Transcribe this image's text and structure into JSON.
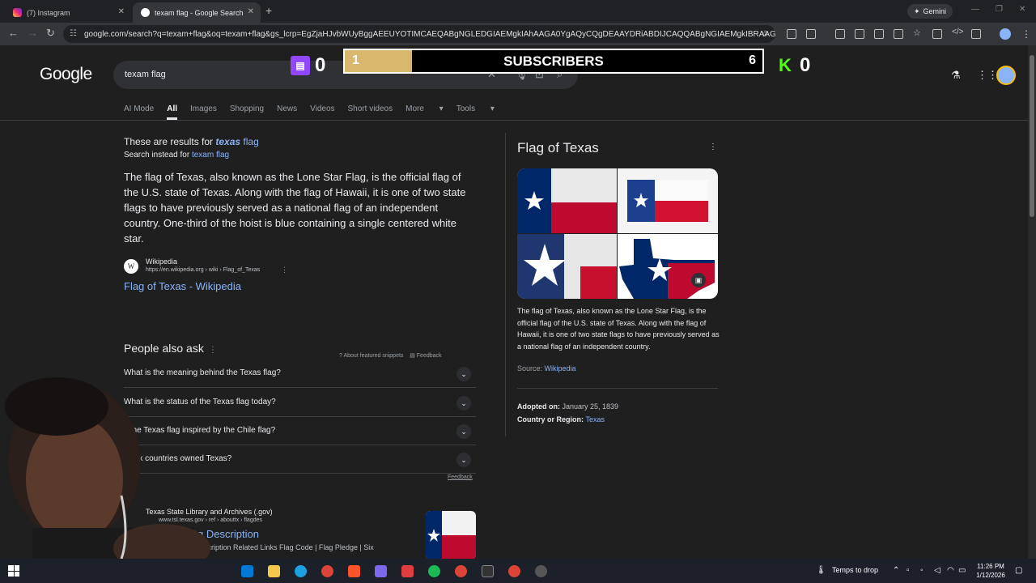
{
  "browser": {
    "tabs": [
      {
        "label": "(7) Instagram",
        "active": false
      },
      {
        "label": "texam flag - Google Search",
        "active": true
      }
    ],
    "gemini_label": "Gemini",
    "url": "google.com/search?q=texam+flag&oq=texam+flag&gs_lcrp=EgZjaHJvbWUyBggAEEUYOTIMCAEQABgNGLEDGIAEMgkIAhAAGA0YgAQyCQgDEAAYDRiABDIJCAQQABgNGIAEMgkIBRAAGA0YgAQyCQ..."
  },
  "google": {
    "logo": "Google",
    "query": "texam flag",
    "filters": [
      "AI Mode",
      "All",
      "Images",
      "Shopping",
      "News",
      "Videos",
      "Short videos",
      "More",
      "Tools"
    ],
    "active_filter": "All"
  },
  "correction": {
    "prefix": "These are results for ",
    "corrected_bold": "texas",
    "corrected_rest": " flag",
    "instead_prefix": "Search instead for ",
    "instead_link": "texam flag"
  },
  "featured": {
    "snippet": "The flag of Texas, also known as the Lone Star Flag, is the official flag of the U.S. state of Texas. Along with the flag of Hawaii, it is one of two state flags to have previously served as a national flag of an independent country. One-third of the hoist is blue containing a single centered white star.",
    "source_name": "Wikipedia",
    "source_url": "https://en.wikipedia.org › wiki › Flag_of_Texas",
    "title": "Flag of Texas - Wikipedia",
    "about": "About featured snippets",
    "feedback": "Feedback"
  },
  "paa": {
    "heading": "People also ask",
    "questions": [
      "What is the meaning behind the Texas flag?",
      "What is the status of the Texas flag today?",
      "s the Texas flag inspired by the Chile flag?",
      "at six countries owned Texas?"
    ],
    "feedback": "Feedback"
  },
  "result2": {
    "name": "Texas State Library and Archives (.gov)",
    "url": "www.tsl.texas.gov › ref › abouttx › flagdes",
    "title": "Flag Description",
    "desc": "lag Description Related Links Flag Code | Flag Pledge | Six"
  },
  "knowledge": {
    "title": "Flag of Texas",
    "description": "The flag of Texas, also known as the Lone Star Flag, is the official flag of the U.S. state of Texas. Along with the flag of Hawaii, it is one of two state flags to have previously served as a national flag of an independent country.",
    "source_label": "Source: ",
    "source_link": "Wikipedia",
    "adopted_label": "Adopted on: ",
    "adopted_value": "January 25, 1839",
    "region_label": "Country or Region: ",
    "region_value": "Texas"
  },
  "overlay": {
    "twitch_count": "0",
    "sub_current": "1",
    "sub_label": "SUBSCRIBERS",
    "sub_goal": "6",
    "sub_progress": 0.16,
    "kick_count": "0"
  },
  "taskbar": {
    "weather": "Temps to drop",
    "time": "11:26 PM",
    "date": "1/12/2026"
  }
}
